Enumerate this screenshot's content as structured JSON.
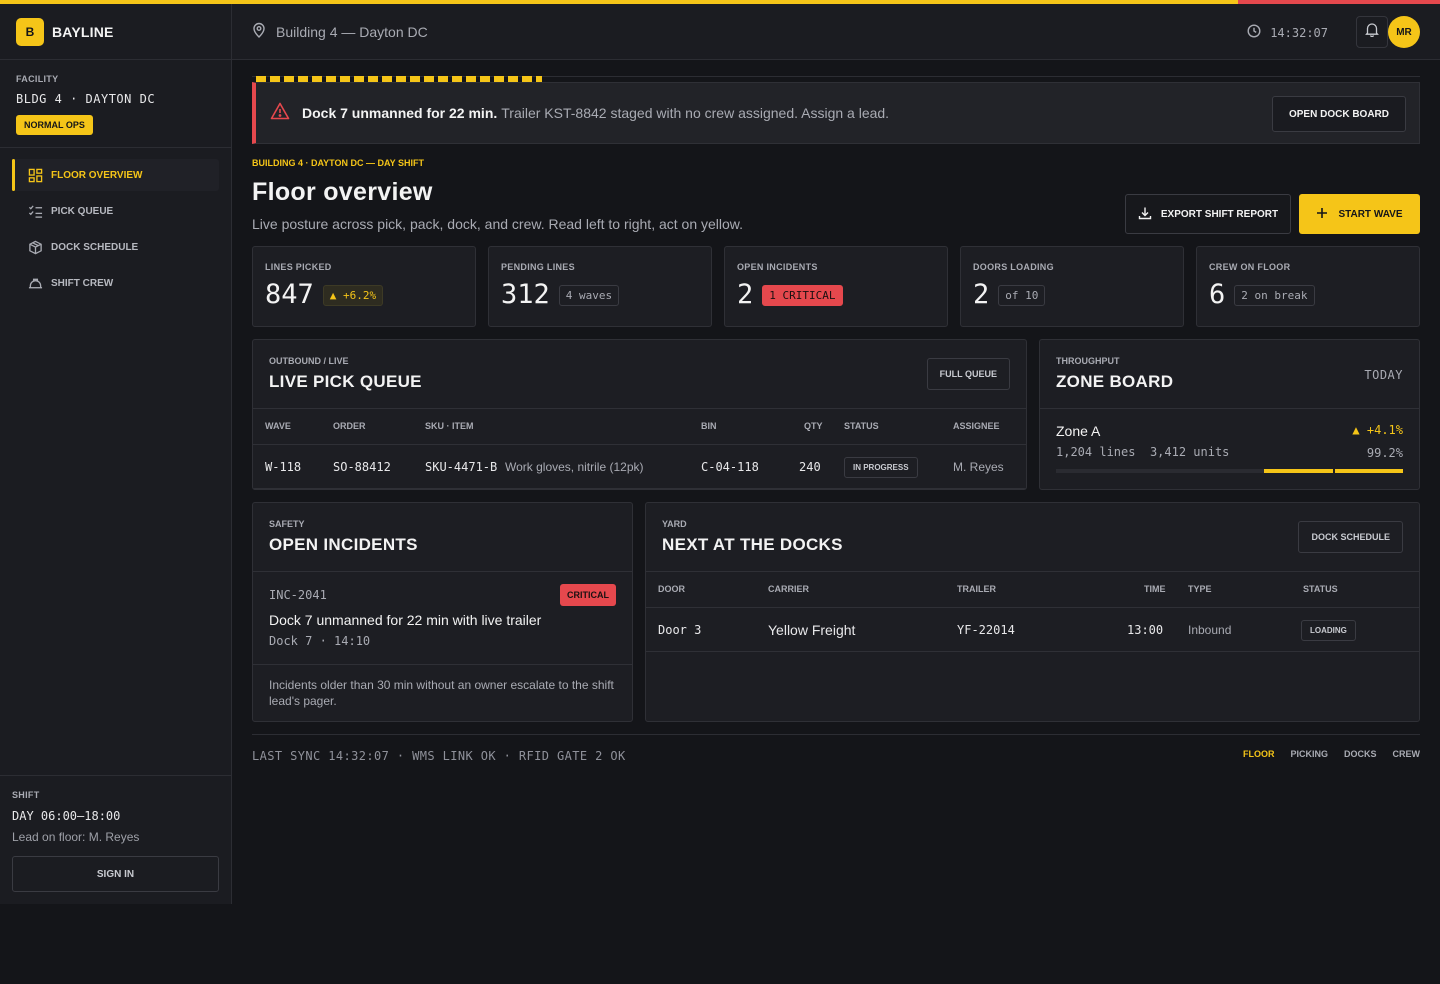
{
  "brand": {
    "logo_letter": "B",
    "name": "BAYLINE"
  },
  "facility": {
    "label": "FACILITY",
    "name": "BLDG 4 · DAYTON DC",
    "status": "NORMAL OPS"
  },
  "nav": {
    "items": [
      {
        "label": "FLOOR OVERVIEW",
        "icon": "dashboard-grid-icon",
        "active": true
      },
      {
        "label": "PICK QUEUE",
        "icon": "checklist-icon",
        "active": false
      },
      {
        "label": "DOCK SCHEDULE",
        "icon": "package-box-icon",
        "active": false
      },
      {
        "label": "SHIFT CREW",
        "icon": "hard-hat-icon",
        "active": false
      }
    ]
  },
  "shift": {
    "label": "SHIFT",
    "time": "DAY 06:00–18:00",
    "lead": "Lead on floor: M. Reyes",
    "signin_label": "SIGN IN"
  },
  "header": {
    "location": "Building 4 — Dayton DC",
    "clock": "14:32:07",
    "avatar_initials": "MR"
  },
  "alert": {
    "headline": "Dock 7 unmanned for 22 min.",
    "detail": "Trailer KST-8842 staged with no crew assigned. Assign a lead.",
    "button": "OPEN DOCK BOARD"
  },
  "page": {
    "breadcrumb": "BUILDING 4 · DAYTON DC — DAY SHIFT",
    "title": "Floor overview",
    "subtitle": "Live posture across pick, pack, dock, and crew. Read left to right, act on yellow.",
    "export_label": "EXPORT SHIFT REPORT",
    "start_label": "START WAVE"
  },
  "kpis": [
    {
      "label": "LINES PICKED",
      "value": "847",
      "chip": "▲ +6.2%",
      "chip_style": "up"
    },
    {
      "label": "PENDING LINES",
      "value": "312",
      "chip": "4 waves",
      "chip_style": "neutral"
    },
    {
      "label": "OPEN INCIDENTS",
      "value": "2",
      "chip": "1 CRITICAL",
      "chip_style": "crit"
    },
    {
      "label": "DOORS LOADING",
      "value": "2",
      "chip": "of 10",
      "chip_style": "neutral"
    },
    {
      "label": "CREW ON FLOOR",
      "value": "6",
      "chip": "2 on break",
      "chip_style": "neutral"
    }
  ],
  "pick_queue": {
    "kicker": "OUTBOUND / LIVE",
    "title": "LIVE PICK QUEUE",
    "button": "FULL QUEUE",
    "columns": [
      "WAVE",
      "ORDER",
      "SKU · ITEM",
      "BIN",
      "QTY",
      "STATUS",
      "ASSIGNEE"
    ],
    "rows": [
      {
        "wave": "W-118",
        "order": "SO-88412",
        "sku": "SKU-4471-B",
        "item": "Work gloves, nitrile (12pk)",
        "bin": "C-04-118",
        "qty": "240",
        "status": "IN PROGRESS",
        "assignee": "M. Reyes"
      }
    ]
  },
  "zone_board": {
    "kicker": "THROUGHPUT",
    "title": "ZONE BOARD",
    "period": "TODAY",
    "zones": [
      {
        "name": "Zone A",
        "delta": "▲ +4.1%",
        "lines": "1,204 lines",
        "units": "3,412 units",
        "pct_label": "99.2%",
        "fill_fraction": 0.4
      }
    ]
  },
  "incidents": {
    "kicker": "SAFETY",
    "title": "OPEN INCIDENTS",
    "items": [
      {
        "id": "INC-2041",
        "severity": "CRITICAL",
        "title": "Dock 7 unmanned for 22 min with live trailer",
        "meta": "Dock 7 · 14:10"
      }
    ],
    "note": "Incidents older than 30 min without an owner escalate to the shift lead's pager."
  },
  "docks": {
    "kicker": "YARD",
    "title": "NEXT AT THE DOCKS",
    "button": "DOCK SCHEDULE",
    "columns": [
      "DOOR",
      "CARRIER",
      "TRAILER",
      "TIME",
      "TYPE",
      "STATUS"
    ],
    "rows": [
      {
        "door": "Door 3",
        "carrier": "Yellow Freight",
        "trailer": "YF-22014",
        "time": "13:00",
        "type": "Inbound",
        "status": "LOADING"
      }
    ]
  },
  "footer": {
    "status": "LAST SYNC 14:32:07 · WMS LINK OK · RFID GATE 2 OK",
    "links": [
      {
        "label": "FLOOR",
        "active": true
      },
      {
        "label": "PICKING",
        "active": false
      },
      {
        "label": "DOCKS",
        "active": false
      },
      {
        "label": "CREW",
        "active": false
      }
    ]
  },
  "colors": {
    "accent": "#f5c518",
    "danger": "#e5484d",
    "background": "#141519",
    "surface": "#1d1e23"
  }
}
